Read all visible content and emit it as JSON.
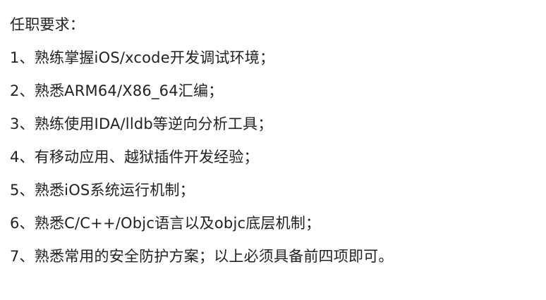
{
  "title": "任职要求：",
  "requirements": [
    "1、熟练掌握iOS/xcode开发调试环境；",
    "2、熟悉ARM64/X86_64汇编；",
    "3、熟练使用IDA/lldb等逆向分析工具；",
    "4、有移动应用、越狱插件开发经验；",
    "5、熟悉iOS系统运行机制；",
    "6、熟悉C/C++/Objc语言以及objc底层机制；",
    "7、熟悉常用的安全防护方案；以上必须具备前四项即可。"
  ]
}
